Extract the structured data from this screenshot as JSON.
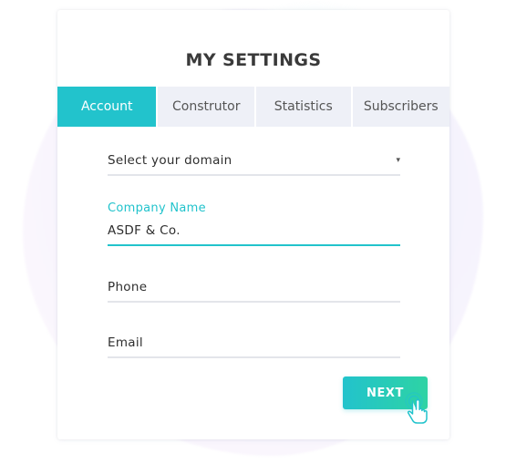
{
  "title": "MY SETTINGS",
  "tabs": [
    {
      "label": "Account",
      "active": true
    },
    {
      "label": "Construtor",
      "active": false
    },
    {
      "label": "Statistics",
      "active": false
    },
    {
      "label": "Subscribers",
      "active": false
    }
  ],
  "form": {
    "domain": {
      "placeholder": "Select your domain",
      "caret": "▾"
    },
    "company": {
      "label": "Company Name",
      "value": "ASDF & Co."
    },
    "phone": {
      "placeholder": "Phone"
    },
    "email": {
      "placeholder": "Email"
    },
    "next_label": "NEXT"
  },
  "colors": {
    "accent": "#22c3cc",
    "accent_end": "#2ed3a4"
  },
  "icons": {
    "pointer": "hand-pointer-icon"
  }
}
